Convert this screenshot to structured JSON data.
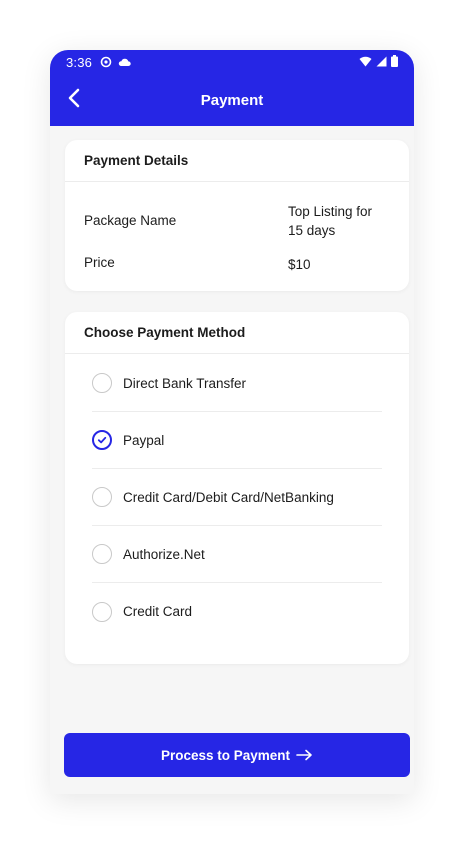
{
  "status_bar": {
    "time": "3:36",
    "icons": [
      "sync-icon",
      "cloud-icon",
      "wifi-icon",
      "signal-icon",
      "battery-icon"
    ]
  },
  "header": {
    "title": "Payment",
    "back_icon": "chevron-left-icon"
  },
  "payment_details": {
    "title": "Payment Details",
    "package_label": "Package Name",
    "package_value_line1": "Top Listing for",
    "package_value_line2": "15 days",
    "price_label": "Price",
    "price_value": "$10"
  },
  "payment_methods": {
    "title": "Choose Payment Method",
    "selected": "Paypal",
    "items": [
      {
        "label": "Direct Bank Transfer",
        "checked": false
      },
      {
        "label": "Paypal",
        "checked": true
      },
      {
        "label": "Credit Card/Debit Card/NetBanking",
        "checked": false
      },
      {
        "label": "Authorize.Net",
        "checked": false
      },
      {
        "label": "Credit Card",
        "checked": false
      }
    ]
  },
  "action": {
    "label": "Process to Payment",
    "icon": "arrow-right-icon"
  },
  "colors": {
    "accent": "#2626e5",
    "background": "#f6f6f6",
    "card": "#ffffff",
    "divider": "#ececec"
  }
}
